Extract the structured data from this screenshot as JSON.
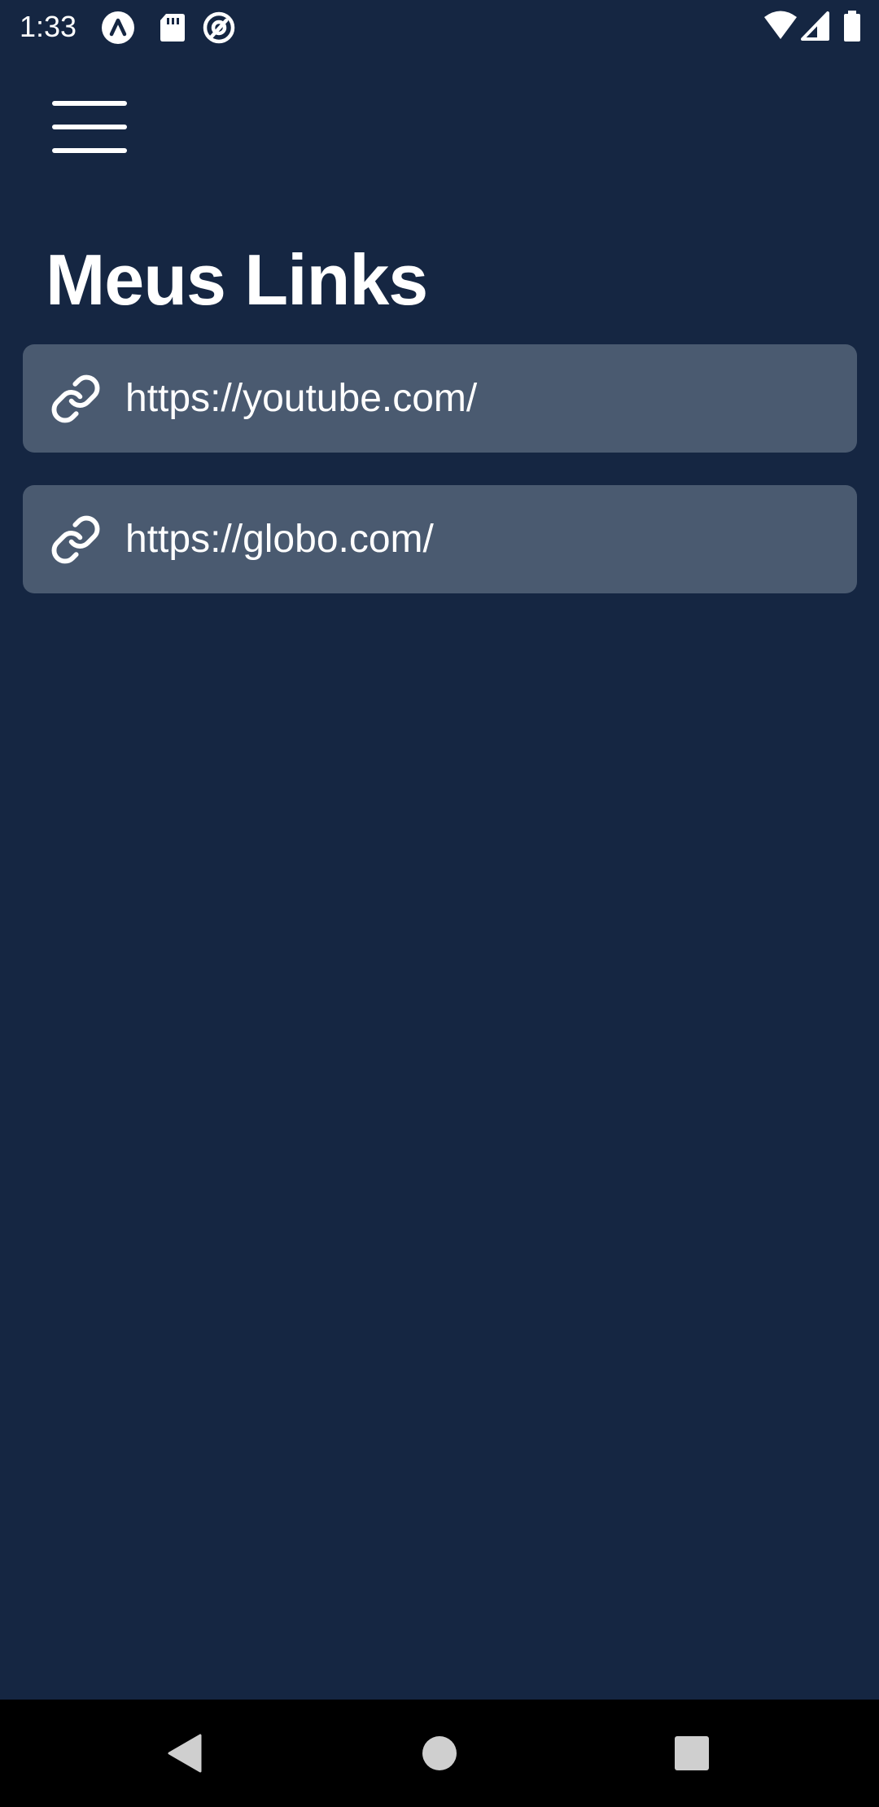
{
  "status_bar": {
    "time": "1:33",
    "left_icons": [
      "app-a-icon",
      "sd-card-icon",
      "at-sign-icon"
    ],
    "right_icons": [
      "wifi-icon",
      "cell-signal-icon",
      "battery-icon"
    ]
  },
  "header": {
    "menu_icon": "hamburger-menu-icon",
    "title": "Meus Links"
  },
  "links": [
    {
      "icon": "link-icon",
      "url": "https://youtube.com/"
    },
    {
      "icon": "link-icon",
      "url": "https://globo.com/"
    }
  ],
  "nav_bar": {
    "buttons": [
      "back-icon",
      "home-icon",
      "recents-icon"
    ]
  },
  "colors": {
    "background": "#152642",
    "card": "#4a5a70",
    "text": "#ffffff",
    "nav_bar": "#000000"
  }
}
